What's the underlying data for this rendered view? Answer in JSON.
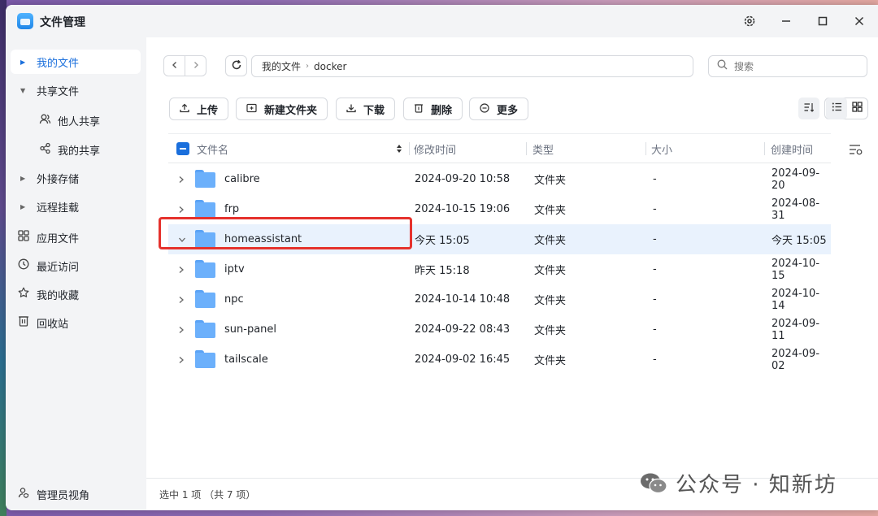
{
  "window": {
    "title": "文件管理",
    "controls": [
      "gear-icon",
      "minimize-icon",
      "maximize-icon",
      "close-icon"
    ]
  },
  "sidebar": {
    "items": [
      {
        "label": "我的文件",
        "icon": "caret-right-icon",
        "active": true
      },
      {
        "label": "共享文件",
        "icon": "caret-down-icon"
      },
      {
        "label": "他人共享",
        "icon": "users-icon",
        "sub": true
      },
      {
        "label": "我的共享",
        "icon": "share-icon",
        "sub": true
      },
      {
        "label": "外接存储",
        "icon": "caret-right-icon"
      },
      {
        "label": "远程挂载",
        "icon": "caret-right-icon"
      },
      {
        "label": "应用文件",
        "icon": "apps-icon"
      },
      {
        "label": "最近访问",
        "icon": "clock-icon"
      },
      {
        "label": "我的收藏",
        "icon": "star-icon"
      },
      {
        "label": "回收站",
        "icon": "trash-icon"
      }
    ],
    "footer": "管理员视角"
  },
  "path": {
    "segments": [
      "我的文件",
      "docker"
    ]
  },
  "search": {
    "placeholder": "搜索"
  },
  "toolbar": {
    "upload": "上传",
    "new_folder": "新建文件夹",
    "download": "下载",
    "delete": "删除",
    "more": "更多"
  },
  "table": {
    "columns": [
      "文件名",
      "修改时间",
      "类型",
      "大小",
      "创建时间"
    ],
    "rows": [
      {
        "name": "calibre",
        "modified": "2024-09-20 10:58",
        "type": "文件夹",
        "size": "-",
        "created": "2024-09-20"
      },
      {
        "name": "frp",
        "modified": "2024-10-15 19:06",
        "type": "文件夹",
        "size": "-",
        "created": "2024-08-31"
      },
      {
        "name": "homeassistant",
        "modified": "今天 15:05",
        "type": "文件夹",
        "size": "-",
        "created": "今天 15:05",
        "selected": true
      },
      {
        "name": "iptv",
        "modified": "昨天 15:18",
        "type": "文件夹",
        "size": "-",
        "created": "2024-10-15"
      },
      {
        "name": "npc",
        "modified": "2024-10-14 10:48",
        "type": "文件夹",
        "size": "-",
        "created": "2024-10-14"
      },
      {
        "name": "sun-panel",
        "modified": "2024-09-22 08:43",
        "type": "文件夹",
        "size": "-",
        "created": "2024-09-11"
      },
      {
        "name": "tailscale",
        "modified": "2024-09-02 16:45",
        "type": "文件夹",
        "size": "-",
        "created": "2024-09-02"
      }
    ]
  },
  "status": {
    "text": "选中 1 项 （共 7 项）"
  },
  "watermark": {
    "text": "公众号 · 知新坊"
  },
  "colors": {
    "accent": "#1a6fdc",
    "highlight_box": "#e5322d",
    "selected_row": "#e9f2fd",
    "folder": "#6cb0fb"
  }
}
